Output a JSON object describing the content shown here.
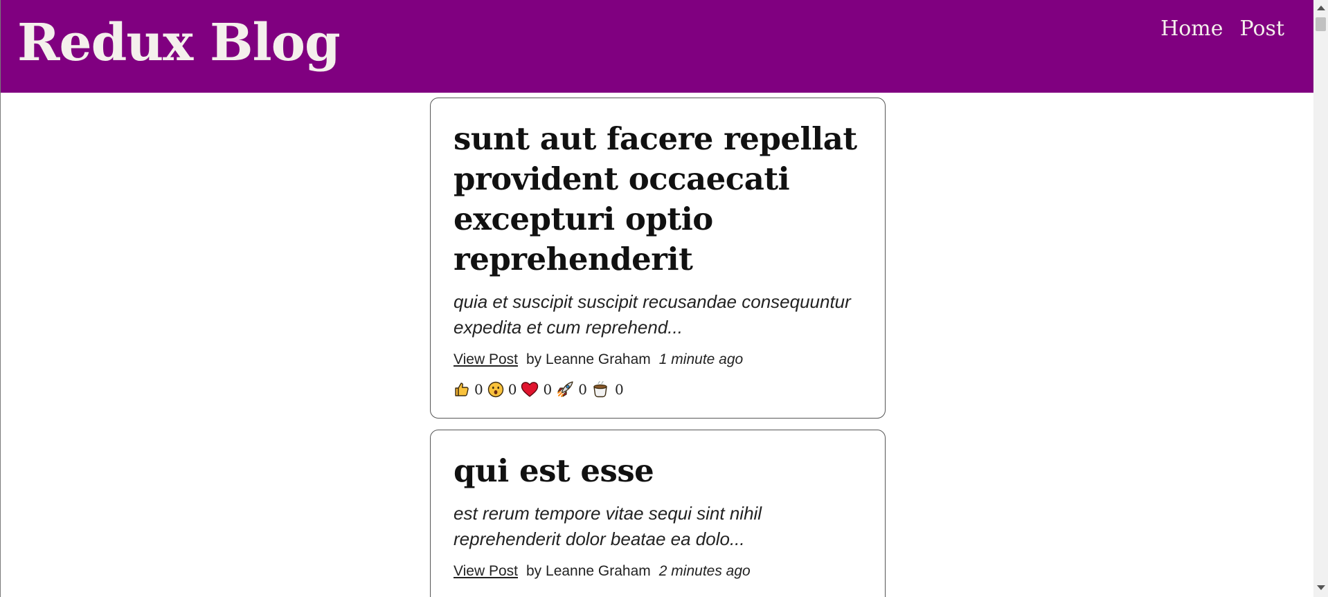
{
  "header": {
    "title": "Redux Blog",
    "nav": [
      {
        "label": "Home"
      },
      {
        "label": "Post"
      }
    ]
  },
  "posts": [
    {
      "title": "sunt aut facere repellat provident occaecati excepturi optio reprehenderit",
      "excerpt": "quia et suscipit suscipit recusandae consequuntur expedita et cum reprehend...",
      "view_label": "View Post",
      "author": "by Leanne Graham",
      "time_ago": "1 minute ago",
      "reactions": [
        {
          "icon": "thumbs-up-icon",
          "count": "0"
        },
        {
          "icon": "wow-icon",
          "count": "0"
        },
        {
          "icon": "heart-icon",
          "count": "0"
        },
        {
          "icon": "rocket-icon",
          "count": "0"
        },
        {
          "icon": "coffee-icon",
          "count": "0"
        }
      ]
    },
    {
      "title": "qui est esse",
      "excerpt": "est rerum tempore vitae sequi sint nihil reprehenderit dolor beatae ea dolo...",
      "view_label": "View Post",
      "author": "by Leanne Graham",
      "time_ago": "2 minutes ago"
    }
  ],
  "colors": {
    "header_bg": "#800080",
    "header_text": "#f4f0ec"
  }
}
